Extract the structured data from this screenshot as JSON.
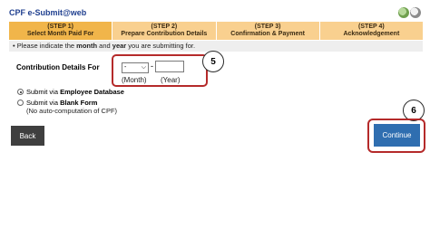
{
  "app": {
    "title": "CPF e-Submit@web"
  },
  "steps": [
    {
      "step": "(STEP 1)",
      "label": "Select Month Paid For",
      "active": true
    },
    {
      "step": "(STEP 2)",
      "label": "Prepare Contribution Details",
      "active": false
    },
    {
      "step": "(STEP 3)",
      "label": "Confirmation & Payment",
      "active": false
    },
    {
      "step": "(STEP 4)",
      "label": "Acknowledgement",
      "active": false
    }
  ],
  "instruction": {
    "prefix": "• Please indicate the ",
    "bold1": "month",
    "mid": " and ",
    "bold2": "year",
    "suffix": " you are submitting for."
  },
  "contribution": {
    "label": "Contribution Details For",
    "month_value": "-",
    "separator": "-",
    "year_value": "",
    "month_hint": "(Month)",
    "year_hint": "(Year)"
  },
  "submit_options": {
    "option1_prefix": "Submit via ",
    "option1_bold": "Employee Database",
    "option2_prefix": "Submit via ",
    "option2_bold": "Blank Form",
    "option2_note": "(No auto-computation of CPF)",
    "selected": "option1"
  },
  "buttons": {
    "back": "Back",
    "continue": "Continue"
  },
  "callouts": {
    "five": "5",
    "six": "6"
  },
  "colors": {
    "step_active": "#f1b54a",
    "step_inactive": "#f9d08f",
    "continue": "#2f6eb0",
    "back": "#3f3f3f",
    "callout_ring": "#b52a2a",
    "title": "#1f3f8f"
  },
  "icons": [
    "refresh-icon",
    "search-icon",
    "chevron-down-icon"
  ]
}
